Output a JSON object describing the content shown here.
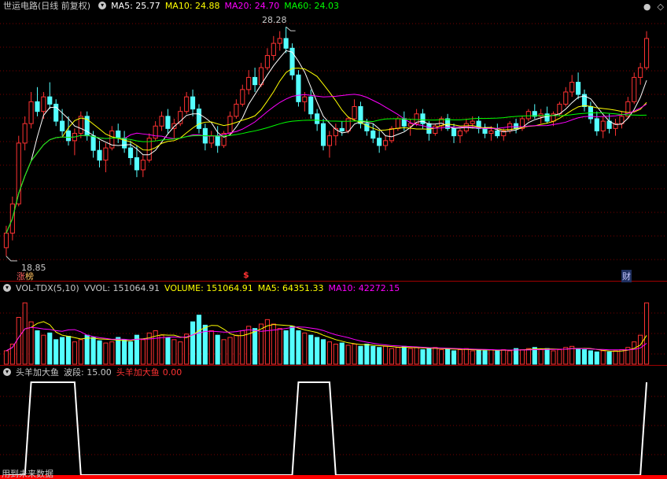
{
  "main_header": {
    "stock_name": "世运电路",
    "period": "(日线 前复权)",
    "ma5": {
      "label": "MA5: 25.77",
      "color": "#ffffff"
    },
    "ma10": {
      "label": "MA10: 24.88",
      "color": "#ffff00"
    },
    "ma20": {
      "label": "MA20: 24.70",
      "color": "#ff00ff"
    },
    "ma60": {
      "label": "MA60: 24.03",
      "color": "#00ff00"
    }
  },
  "price_annotations": {
    "high": "28.28",
    "low": "18.85",
    "marker_left": "涨",
    "marker_left2": "榜",
    "marker_mid": "$",
    "marker_right": "财"
  },
  "vol_header": {
    "name": "VOL-TDX(5,10)",
    "vvol": "VVOL: 151064.91",
    "volume": "VOLUME: 151064.91",
    "ma5": "MA5: 64351.33",
    "ma10": "MA10: 42272.15"
  },
  "ind_header": {
    "name": "头羊加大鱼",
    "wave": "波段: 15.00",
    "signal_name": "头羊加大鱼",
    "signal_value": "0.00"
  },
  "footer_note": "用到未来数据",
  "colors": {
    "up": "#ff3232",
    "down": "#54ffff",
    "grid": "#7a0000",
    "ma5": "#ffffff",
    "ma10": "#ffff00",
    "ma20": "#ff00ff",
    "ma60": "#00ff00"
  },
  "chart_data": {
    "type": "candlestick",
    "y_range": [
      18.85,
      28.28
    ],
    "candles": [
      [
        19.2,
        20.1,
        18.85,
        19.8
      ],
      [
        19.8,
        21.3,
        19.5,
        21.0
      ],
      [
        21.0,
        23.8,
        20.9,
        23.5
      ],
      [
        23.5,
        24.6,
        23.2,
        24.3
      ],
      [
        24.3,
        25.6,
        24.1,
        25.2
      ],
      [
        25.2,
        25.8,
        24.6,
        24.8
      ],
      [
        24.8,
        25.6,
        24.5,
        25.4
      ],
      [
        25.4,
        26.0,
        24.9,
        25.1
      ],
      [
        25.1,
        25.3,
        24.2,
        24.4
      ],
      [
        24.4,
        24.9,
        23.8,
        24.0
      ],
      [
        24.0,
        24.6,
        23.4,
        23.6
      ],
      [
        23.6,
        24.1,
        23.0,
        23.9
      ],
      [
        23.9,
        24.8,
        23.7,
        24.6
      ],
      [
        24.6,
        24.8,
        23.6,
        23.8
      ],
      [
        23.8,
        24.0,
        22.9,
        23.2
      ],
      [
        23.2,
        23.6,
        22.5,
        22.8
      ],
      [
        22.8,
        23.5,
        22.3,
        23.3
      ],
      [
        23.3,
        24.2,
        23.2,
        24.0
      ],
      [
        24.0,
        24.3,
        23.5,
        23.7
      ],
      [
        23.7,
        24.0,
        23.1,
        23.3
      ],
      [
        23.3,
        23.6,
        22.6,
        22.9
      ],
      [
        22.9,
        23.4,
        22.1,
        22.4
      ],
      [
        22.4,
        23.0,
        22.1,
        22.8
      ],
      [
        22.8,
        23.9,
        22.7,
        23.7
      ],
      [
        23.7,
        24.4,
        23.6,
        24.2
      ],
      [
        24.2,
        24.8,
        24.0,
        24.6
      ],
      [
        24.6,
        24.9,
        23.9,
        24.1
      ],
      [
        24.1,
        24.5,
        23.7,
        24.3
      ],
      [
        24.3,
        25.0,
        24.2,
        24.8
      ],
      [
        24.8,
        25.6,
        24.7,
        25.4
      ],
      [
        25.4,
        25.7,
        24.6,
        24.9
      ],
      [
        24.9,
        25.1,
        23.9,
        24.1
      ],
      [
        24.1,
        24.3,
        23.2,
        23.5
      ],
      [
        23.5,
        24.0,
        23.3,
        23.8
      ],
      [
        23.8,
        24.2,
        23.1,
        23.4
      ],
      [
        23.4,
        24.0,
        23.3,
        23.9
      ],
      [
        23.9,
        24.8,
        23.8,
        24.6
      ],
      [
        24.6,
        25.3,
        24.5,
        25.1
      ],
      [
        25.1,
        25.9,
        25.0,
        25.7
      ],
      [
        25.7,
        26.5,
        25.5,
        26.2
      ],
      [
        26.2,
        26.6,
        25.6,
        25.9
      ],
      [
        25.9,
        26.8,
        25.8,
        26.6
      ],
      [
        26.6,
        27.4,
        26.5,
        27.1
      ],
      [
        27.1,
        27.9,
        26.9,
        27.6
      ],
      [
        27.6,
        28.1,
        27.3,
        27.8
      ],
      [
        27.8,
        28.28,
        27.2,
        27.4
      ],
      [
        27.4,
        27.6,
        26.1,
        26.3
      ],
      [
        26.3,
        26.5,
        25.0,
        25.2
      ],
      [
        25.2,
        25.6,
        24.8,
        25.4
      ],
      [
        25.4,
        25.7,
        24.5,
        24.7
      ],
      [
        24.7,
        24.9,
        24.0,
        24.3
      ],
      [
        24.3,
        24.5,
        23.2,
        23.4
      ],
      [
        23.4,
        24.0,
        22.9,
        23.8
      ],
      [
        23.8,
        24.3,
        23.4,
        24.1
      ],
      [
        24.1,
        24.4,
        23.8,
        24.0
      ],
      [
        24.0,
        24.6,
        23.9,
        24.5
      ],
      [
        24.5,
        25.3,
        24.4,
        25.0
      ],
      [
        25.0,
        25.2,
        24.1,
        24.3
      ],
      [
        24.3,
        24.5,
        23.8,
        24.0
      ],
      [
        24.0,
        24.3,
        23.5,
        23.7
      ],
      [
        23.7,
        24.0,
        23.1,
        23.4
      ],
      [
        23.4,
        23.8,
        23.2,
        23.6
      ],
      [
        23.6,
        24.2,
        23.5,
        24.1
      ],
      [
        24.1,
        24.6,
        24.0,
        24.5
      ],
      [
        24.5,
        24.8,
        24.0,
        24.2
      ],
      [
        24.2,
        24.5,
        23.8,
        24.3
      ],
      [
        24.3,
        24.9,
        24.2,
        24.7
      ],
      [
        24.7,
        24.9,
        24.1,
        24.3
      ],
      [
        24.3,
        24.4,
        23.6,
        23.9
      ],
      [
        23.9,
        24.3,
        23.8,
        24.2
      ],
      [
        24.2,
        24.6,
        24.0,
        24.5
      ],
      [
        24.5,
        24.7,
        24.0,
        24.1
      ],
      [
        24.1,
        24.3,
        23.5,
        23.8
      ],
      [
        23.8,
        24.1,
        23.5,
        24.0
      ],
      [
        24.0,
        24.5,
        23.9,
        24.3
      ],
      [
        24.3,
        24.6,
        24.1,
        24.4
      ],
      [
        24.4,
        24.6,
        23.9,
        24.1
      ],
      [
        24.1,
        24.3,
        23.7,
        23.9
      ],
      [
        23.9,
        24.2,
        23.6,
        24.0
      ],
      [
        24.0,
        24.3,
        23.7,
        23.8
      ],
      [
        23.8,
        24.1,
        23.6,
        24.0
      ],
      [
        24.0,
        24.4,
        23.9,
        24.3
      ],
      [
        24.3,
        24.5,
        23.9,
        24.1
      ],
      [
        24.1,
        24.6,
        24.0,
        24.5
      ],
      [
        24.5,
        24.9,
        24.4,
        24.8
      ],
      [
        24.8,
        25.1,
        24.5,
        24.6
      ],
      [
        24.6,
        24.9,
        24.3,
        24.7
      ],
      [
        24.7,
        25.0,
        24.3,
        24.4
      ],
      [
        24.4,
        24.8,
        24.2,
        24.7
      ],
      [
        24.7,
        25.2,
        24.6,
        25.1
      ],
      [
        25.1,
        25.8,
        25.0,
        25.6
      ],
      [
        25.6,
        26.3,
        25.4,
        26.0
      ],
      [
        26.0,
        26.4,
        25.3,
        25.5
      ],
      [
        25.5,
        25.7,
        24.8,
        25.0
      ],
      [
        25.0,
        25.2,
        24.3,
        24.5
      ],
      [
        24.5,
        24.8,
        23.8,
        24.0
      ],
      [
        24.0,
        24.6,
        23.7,
        24.4
      ],
      [
        24.4,
        24.7,
        23.9,
        24.1
      ],
      [
        24.1,
        24.5,
        23.8,
        24.3
      ],
      [
        24.3,
        24.8,
        24.1,
        24.6
      ],
      [
        24.6,
        25.4,
        24.5,
        25.2
      ],
      [
        25.2,
        26.4,
        25.1,
        26.2
      ],
      [
        26.2,
        26.8,
        25.9,
        26.6
      ],
      [
        26.6,
        28.1,
        26.5,
        27.8
      ]
    ],
    "volumes": [
      12,
      18,
      42,
      55,
      38,
      30,
      26,
      28,
      22,
      24,
      25,
      20,
      22,
      26,
      24,
      21,
      19,
      20,
      24,
      22,
      20,
      26,
      22,
      28,
      30,
      26,
      24,
      22,
      20,
      27,
      38,
      44,
      35,
      30,
      26,
      22,
      24,
      26,
      30,
      34,
      32,
      36,
      40,
      36,
      32,
      30,
      34,
      30,
      28,
      26,
      24,
      22,
      20,
      18,
      19,
      17,
      18,
      16,
      18,
      16,
      15,
      16,
      14,
      15,
      16,
      14,
      15,
      13,
      14,
      15,
      13,
      14,
      12,
      13,
      14,
      12,
      13,
      12,
      13,
      12,
      13,
      12,
      14,
      13,
      14,
      15,
      13,
      14,
      12,
      13,
      15,
      16,
      14,
      13,
      12,
      11,
      12,
      11,
      12,
      13,
      15,
      20,
      26,
      55
    ],
    "signal_periods": [
      [
        4,
        11
      ],
      [
        47,
        52
      ],
      [
        103,
        104
      ]
    ]
  }
}
